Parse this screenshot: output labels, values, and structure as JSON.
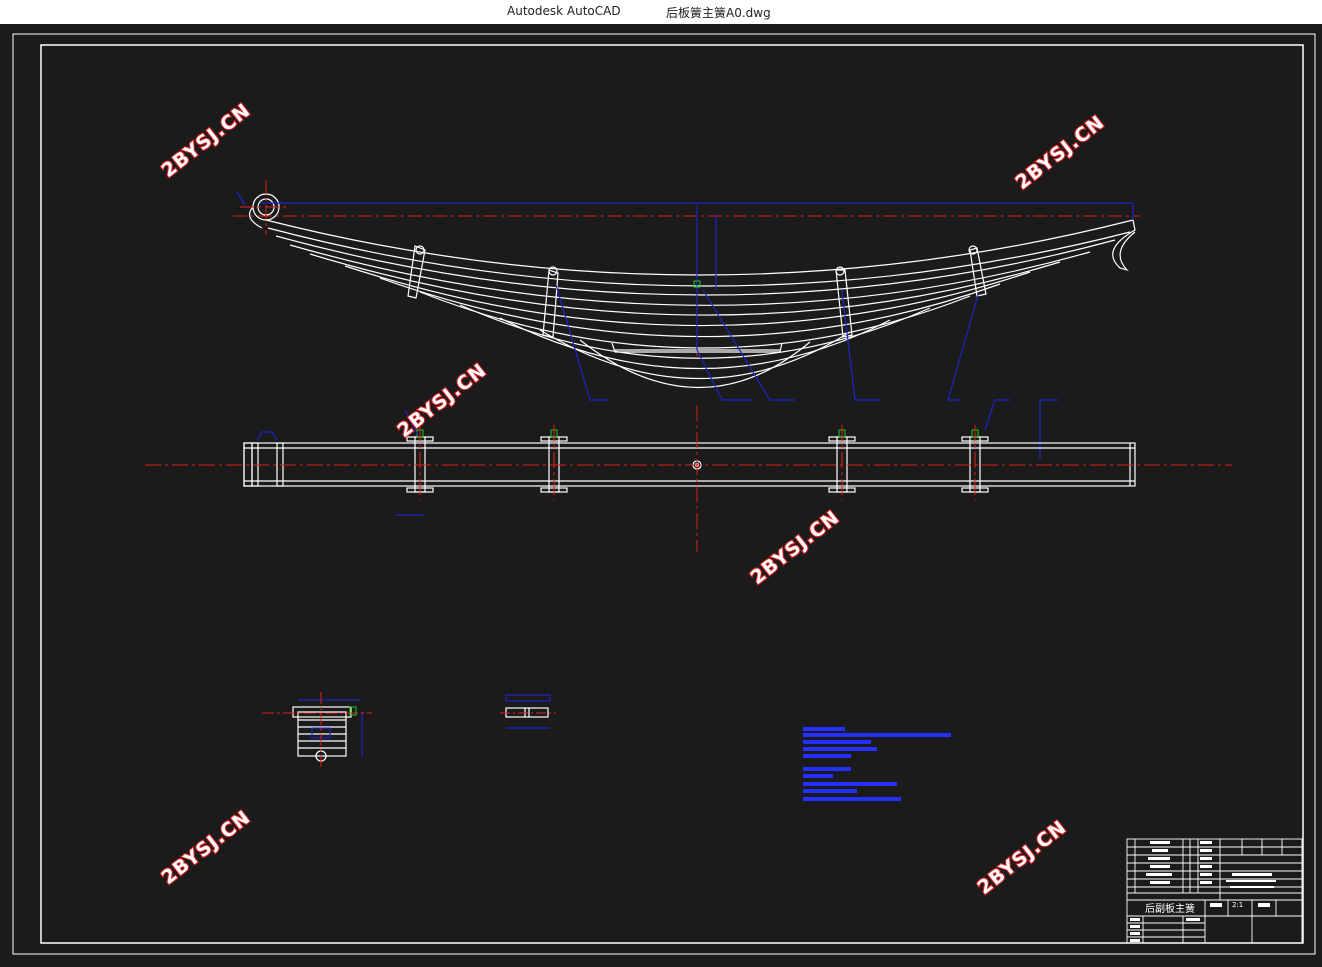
{
  "window": {
    "app_name": "Autodesk AutoCAD",
    "document_name": "后板簧主簧A0.dwg"
  },
  "drawing": {
    "watermark_text": "2BYSJ.CN",
    "title_block_name": "后副板主簧",
    "scale_text": "2:1",
    "colors": {
      "background": "#1b1b1b",
      "geometry": "#ffffff",
      "centerline": "#e01c1c",
      "dimension": "#1c24c8",
      "annotation": "#2430ff",
      "bolt": "#19c819",
      "watermark_outline": "#d42020"
    }
  }
}
